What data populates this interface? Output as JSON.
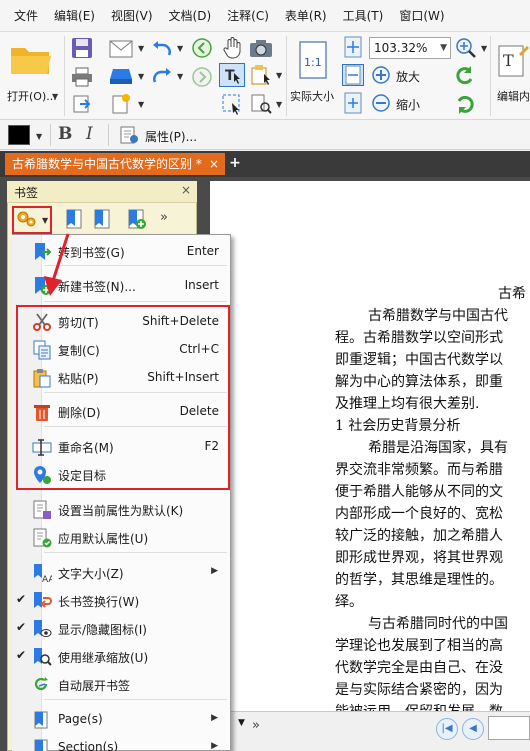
{
  "menubar": {
    "items": [
      "文件",
      "编辑(E)",
      "视图(V)",
      "文档(D)",
      "注释(C)",
      "表单(R)",
      "工具(T)",
      "窗口(W)"
    ]
  },
  "ribbon": {
    "open_label": "打开(O)...",
    "zoom_value": "103.32%",
    "actual_size_label": "实际大小",
    "zoom_in_label": "放大",
    "zoom_out_label": "缩小",
    "edit_content_label": "编辑内"
  },
  "format_bar": {
    "bold": "B",
    "italic": "I",
    "properties_label": "属性(P)..."
  },
  "tabs": {
    "doc_tab": "古希腊数学与中国古代数学的区别 *",
    "close": "×",
    "new_tab": "+"
  },
  "bookmark_panel": {
    "title": "书签",
    "close": "×",
    "more": "»"
  },
  "context_menu": {
    "items": [
      {
        "label": "转到书签(G)",
        "shortcut": "Enter",
        "icon": "goto-bookmark-icon"
      },
      {
        "label": "新建书签(N)...",
        "shortcut": "Insert",
        "icon": "new-bookmark-icon"
      },
      {
        "label": "剪切(T)",
        "shortcut": "Shift+Delete",
        "icon": "scissors-icon"
      },
      {
        "label": "复制(C)",
        "shortcut": "Ctrl+C",
        "icon": "copy-icon"
      },
      {
        "label": "粘贴(P)",
        "shortcut": "Shift+Insert",
        "icon": "paste-icon"
      },
      {
        "label": "删除(D)",
        "shortcut": "Delete",
        "icon": "trash-icon"
      },
      {
        "label": "重命名(M)",
        "shortcut": "F2",
        "icon": "rename-icon"
      },
      {
        "label": "设定目标",
        "shortcut": "",
        "icon": "set-destination-icon"
      },
      {
        "label": "设置当前属性为默认(K)",
        "shortcut": "",
        "icon": "set-default-properties-icon"
      },
      {
        "label": "应用默认属性(U)",
        "shortcut": "",
        "icon": "apply-default-properties-icon"
      },
      {
        "label": "文字大小(Z)",
        "shortcut": "",
        "icon": "text-size-icon"
      },
      {
        "label": "长书签换行(W)",
        "shortcut": "",
        "icon": "wrap-bookmark-icon"
      },
      {
        "label": "显示/隐藏图标(I)",
        "shortcut": "",
        "icon": "show-hide-icon"
      },
      {
        "label": "使用继承缩放(U)",
        "shortcut": "",
        "icon": "inherit-zoom-icon"
      },
      {
        "label": "自动展开书签",
        "shortcut": "",
        "icon": "auto-expand-icon"
      },
      {
        "label": "Page(s)",
        "shortcut": "",
        "icon": "pages-icon"
      },
      {
        "label": "Section(s)",
        "shortcut": "",
        "icon": "sections-icon"
      }
    ],
    "checked": [
      "长书签换行(W)",
      "显示/隐藏图标(I)",
      "使用继承缩放(U)"
    ],
    "submenus": [
      "文字大小(Z)",
      "Page(s)",
      "Section(s)"
    ]
  },
  "document": {
    "lines": [
      "古希",
      "古希腊数学与中国古代",
      "程。古希腊数学以空间形式",
      "即重逻辑；中国古代数学以",
      "解为中心的算法体系，即重",
      "及推理上均有很大差别.",
      "1    社会历史背景分析",
      "希腊是沿海国家，具有",
      "界交流非常频繁。而与希腊",
      "便于希腊人能够从不同的文",
      "内部形成一个良好的、宽松",
      "较广泛的接触，加之希腊人",
      "即形成世界观，将其世界观",
      "的哲学，其思维是理性的。",
      "绎。",
      "与古希腊同时代的中国",
      "学理论也发展到了相当的高",
      "代数学完全是由自己、在没",
      "是与实际结合紧密的，因为",
      "能被运用、保留和发展，数"
    ]
  },
  "colors": {
    "accent_tab": "#e26b1d",
    "highlight_red": "#e0222b",
    "panel_bg": "#f7f3d6"
  }
}
